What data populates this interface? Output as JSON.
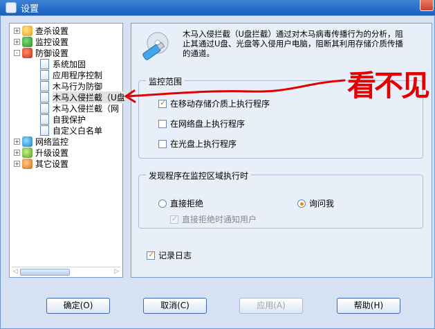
{
  "window": {
    "title": "设置"
  },
  "tree": {
    "nodes": [
      {
        "label": "查杀设置",
        "expander": "+"
      },
      {
        "label": "监控设置",
        "expander": "+"
      },
      {
        "label": "防御设置",
        "expander": "-"
      },
      {
        "label": "系统加固"
      },
      {
        "label": "应用程序控制"
      },
      {
        "label": "木马行为防御"
      },
      {
        "label": "木马入侵拦截（U盘"
      },
      {
        "label": "木马入侵拦截（网"
      },
      {
        "label": "自我保护"
      },
      {
        "label": "自定义白名单"
      },
      {
        "label": "网络监控",
        "expander": "+"
      },
      {
        "label": "升级设置",
        "expander": "+"
      },
      {
        "label": "其它设置",
        "expander": "+"
      }
    ]
  },
  "content": {
    "description": "木马入侵拦截（U盘拦截）通过对木马病毒传播行为的分析，阻止其通过U盘、光盘等入侵用户电脑，阻断其利用存储介质传播的通道。",
    "scope_group": {
      "title": "监控范围",
      "options": [
        {
          "label": "在移动存储介质上执行程序",
          "checked": true
        },
        {
          "label": "在网络盘上执行程序",
          "checked": false
        },
        {
          "label": "在光盘上执行程序",
          "checked": false
        }
      ]
    },
    "action_group": {
      "title": "发现程序在监控区域执行时",
      "reject_label": "直接拒绝",
      "ask_label": "询问我",
      "selected": "ask",
      "notify_label": "直接拒绝时通知用户",
      "notify_checked": true
    },
    "log_label": "记录日志",
    "log_checked": true
  },
  "buttons": {
    "ok": "确定(O)",
    "cancel": "取消(C)",
    "apply": "应用(A)",
    "help": "帮助(H)"
  },
  "annotation": {
    "text": "看不见",
    "color": "#e20000"
  }
}
